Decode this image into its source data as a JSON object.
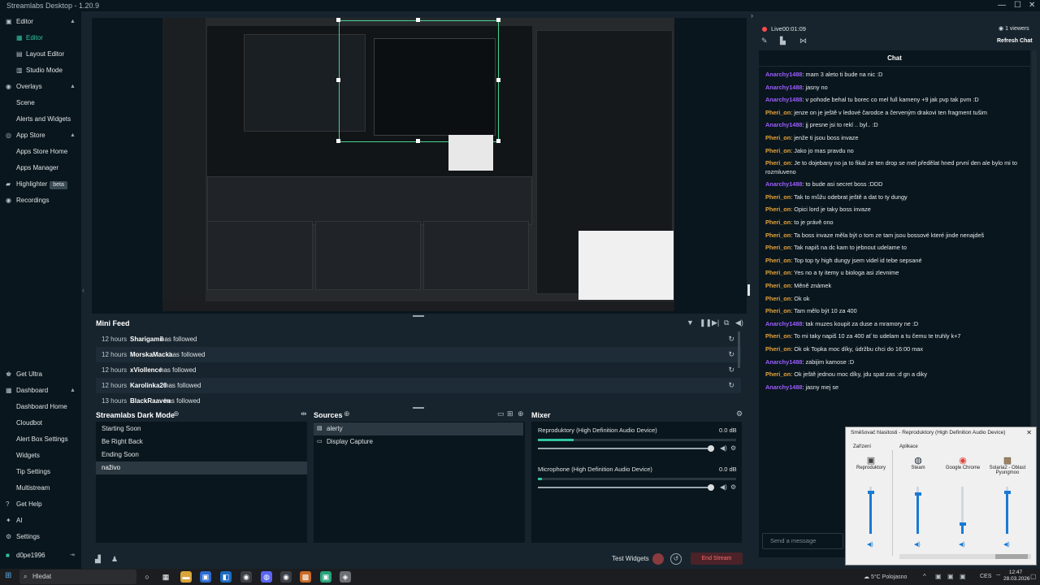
{
  "app": {
    "title": "Streamlabs Desktop - 1.20.9"
  },
  "sidebar": {
    "editor": "Editor",
    "editor_sub": "Editor",
    "layout_editor": "Layout Editor",
    "studio_mode": "Studio Mode",
    "overlays": "Overlays",
    "scene": "Scene",
    "alerts_widgets": "Alerts and Widgets",
    "app_store": "App Store",
    "apps_store_home": "Apps Store Home",
    "apps_manager": "Apps Manager",
    "highlighter": "Highlighter",
    "beta": "beta",
    "recordings": "Recordings",
    "get_ultra": "Get Ultra",
    "dashboard": "Dashboard",
    "dashboard_home": "Dashboard Home",
    "cloudbot": "Cloudbot",
    "alert_box": "Alert Box Settings",
    "widgets": "Widgets",
    "tip_settings": "Tip Settings",
    "multistream": "Multistream",
    "get_help": "Get Help",
    "ai": "AI",
    "settings": "Settings",
    "user": "d0pe1996"
  },
  "minifeed": {
    "title": "Mini Feed",
    "rows": [
      {
        "time": "12 hours",
        "name": "Sharigamii",
        "action": "has followed"
      },
      {
        "time": "12 hours",
        "name": "MorskaMacka",
        "action": "has followed"
      },
      {
        "time": "12 hours",
        "name": "xViollence",
        "action": "has followed"
      },
      {
        "time": "12 hours",
        "name": "Karolinka26",
        "action": "has followed"
      },
      {
        "time": "13 hours",
        "name": "BlackRaaven",
        "action": "has followed"
      }
    ]
  },
  "scenes": {
    "title": "Streamlabs Dark Mode",
    "items": [
      "Starting Soon",
      "Be Right Back",
      "Ending Soon",
      "naživo"
    ]
  },
  "sources": {
    "title": "Sources",
    "items": [
      "alerty",
      "Display Capture"
    ]
  },
  "mixer": {
    "title": "Mixer",
    "channels": [
      {
        "name": "Reproduktory (High Definition Audio Device)",
        "db": "0.0 dB",
        "level": 0.18,
        "volume": 1.0
      },
      {
        "name": "Microphone (High Definition Audio Device)",
        "db": "0.0 dB",
        "level": 0.02,
        "volume": 1.0
      }
    ]
  },
  "footer": {
    "test_widgets": "Test Widgets",
    "end_stream": "End Stream"
  },
  "chat": {
    "live_label": "Live",
    "live_time": "00:01:09",
    "viewers": "1 viewers",
    "refresh": "Refresh Chat",
    "title": "Chat",
    "send_placeholder": "Send a message",
    "messages": [
      {
        "user": "Anarchy1488",
        "text": ": mam 3 aleto ti bude na nic :D",
        "color": "an"
      },
      {
        "user": "Anarchy1488",
        "text": ": jasny no",
        "color": "an"
      },
      {
        "user": "Anarchy1488",
        "text": ": v pohode behal tu borec co mel full kameny +9 jak pvp tak pvm :D",
        "color": "an"
      },
      {
        "user": "Pheri_on",
        "text": ": jenze on je ještě v ledové čarodce a červeným drakovi ten fragment tušim",
        "color": "ph"
      },
      {
        "user": "Anarchy1488",
        "text": ": jj presne jsi to rekl .. byl.. :D",
        "color": "an"
      },
      {
        "user": "Pheri_on",
        "text": ": jenže ti jsou boss invaze",
        "color": "ph"
      },
      {
        "user": "Pheri_on",
        "text": ": Jako jo mas pravdu no",
        "color": "ph"
      },
      {
        "user": "Pheri_on",
        "text": ": Je to dojebany no ja to fikal ze ten drop se mel předělat hned první den ale bylo mi to rozmluveno",
        "color": "ph"
      },
      {
        "user": "Anarchy1488",
        "text": ": to bude asi secret boss :DDD",
        "color": "an"
      },
      {
        "user": "Pheri_on",
        "text": ": Tak to můžu odebrat ještě a dat to ty dungy",
        "color": "ph"
      },
      {
        "user": "Pheri_on",
        "text": ": Opici lord je taky boss invaze",
        "color": "ph"
      },
      {
        "user": "Pheri_on",
        "text": ": to je právě ono",
        "color": "ph"
      },
      {
        "user": "Pheri_on",
        "text": ": Ta boss invaze měla být o tom ze tam jsou bossové které jinde nenajdeš",
        "color": "ph"
      },
      {
        "user": "Pheri_on",
        "text": ": Tak napiš na dc kam to jebnout udelame to",
        "color": "ph"
      },
      {
        "user": "Pheri_on",
        "text": ": Top top ty high dungy jsem videl id tebe sepsané",
        "color": "ph"
      },
      {
        "user": "Pheri_on",
        "text": ": Yes no a ty itemy u biologa asi zlevnime",
        "color": "ph"
      },
      {
        "user": "Pheri_on",
        "text": ": Měně známek",
        "color": "ph"
      },
      {
        "user": "Pheri_on",
        "text": ": Ok ok",
        "color": "ph"
      },
      {
        "user": "Pheri_on",
        "text": ": Tam mělo být 10 za 400",
        "color": "ph"
      },
      {
        "user": "Anarchy1488",
        "text": ": tak muzes koupit za duse a mramory ne :D",
        "color": "an"
      },
      {
        "user": "Pheri_on",
        "text": ": To mi taky napiš 10 za 400 ať to udelam a tu čemu te truhly k+7",
        "color": "ph"
      },
      {
        "user": "Pheri_on",
        "text": ": Ok ok Topka moc díky, údržbu chci do 16:00 max",
        "color": "ph"
      },
      {
        "user": "Anarchy1488",
        "text": ": zabijim kamose :D",
        "color": "an"
      },
      {
        "user": "Pheri_on",
        "text": ": Ok ještě jednou moc díky, jdu spat zas :d gn a diky",
        "color": "ph"
      },
      {
        "user": "Anarchy1488",
        "text": ": jasny mej se",
        "color": "an"
      }
    ]
  },
  "volume_mixer": {
    "title": "Směšovač hlasitosti - Reproduktory (High Definition Audio Device)",
    "device_label": "Zařízení",
    "apps_label": "Aplikace",
    "columns": [
      {
        "name": "Reproduktory",
        "level": 0.88
      },
      {
        "name": "Steam",
        "level": 0.85
      },
      {
        "name": "Google Chrome",
        "level": 0.2
      },
      {
        "name": "Solaria2 - Oblast Pyungmoo",
        "level": 0.88
      }
    ]
  },
  "taskbar": {
    "search": "Hledat",
    "weather": "5°C  Polojasno",
    "lang": "CES",
    "time": "12:47",
    "date": "28.03.2026"
  },
  "colors": {
    "accent": "#31c3a2",
    "bg": "#17242d",
    "panel": "#09161d",
    "end_stream": "#ff6b6b"
  }
}
